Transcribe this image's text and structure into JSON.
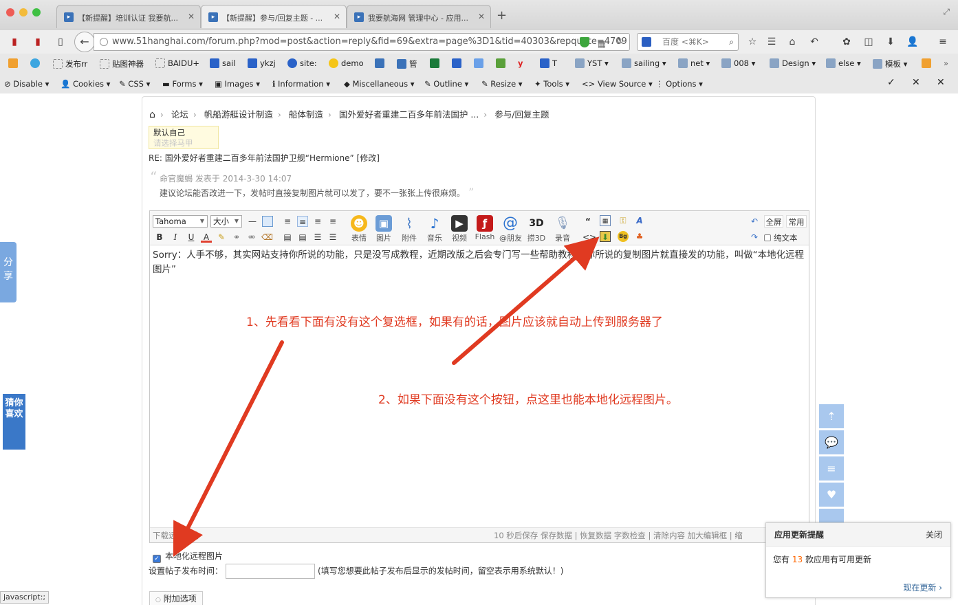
{
  "browser": {
    "tabs": [
      {
        "title": "【新提醒】培训认证 我要航..."
      },
      {
        "title": "【新提醒】参与/回复主题 - ..."
      },
      {
        "title": "我要航海网 管理中心 - 应用..."
      }
    ],
    "new_tab": "+",
    "url": "www.51hanghai.com/forum.php?mod=post&action=reply&fid=69&extra=page%3D1&tid=40303&repquote=4709",
    "search_placeholder": "百度 <⌘K>",
    "bookmarks": [
      "发布rr",
      "贴图神器",
      "BAIDU+",
      "sail",
      "ykzj",
      "site:",
      "demo",
      "管",
      "T"
    ],
    "bookmark_folders": [
      "YST",
      "sailing",
      "net",
      "008",
      "Design",
      "else",
      "模板"
    ],
    "devbar": [
      "Disable",
      "Cookies",
      "CSS",
      "Forms",
      "Images",
      "Information",
      "Miscellaneous",
      "Outline",
      "Resize",
      "Tools",
      "View Source",
      "Options"
    ],
    "status_url": "javascript:;"
  },
  "breadcrumb": [
    "论坛",
    "帆船游艇设计制造",
    "船体制造",
    "国外爱好者重建二百多年前法国护 ...",
    "参与/回复主题"
  ],
  "majia": {
    "label": "默认自己",
    "placeholder": "请选择马甲"
  },
  "reply_title": "RE: 国外爱好者重建二百多年前法国护卫舰“Hermione” [修改]",
  "quote": {
    "author_line": "命官魔蝎 发表于 2014-3-30 14:07",
    "text": "建议论坛能否改进一下，发帖时直接复制图片就可以发了，要不一张张上传很麻烦。"
  },
  "editor": {
    "font": "Tahoma",
    "size": "大小",
    "tools": [
      "表情",
      "图片",
      "附件",
      "音乐",
      "视频",
      "Flash",
      "@朋友",
      "捞3D",
      "录音"
    ],
    "fullscreen": "全屏",
    "common": "常用",
    "plaintext": "纯文本",
    "content": "Sorry：人手不够，其实网站支持你所说的功能，只是没写成教程，近期改版之后会专门写一些帮助教程。你所说的复制图片就直接发的功能，叫做“本地化远程图片”",
    "status_left": "下载远程图片",
    "status_right": "10 秒后保存 保存数据 | 恢复数据    字数检查 | 清除内容    加大编辑框 | 缩"
  },
  "options": {
    "localize_label": "本地化远程图片",
    "post_time_label": "设置帖子发布时间：",
    "post_time_hint": "(填写您想要此帖子发布后显示的发帖时间，留空表示用系统默认！)",
    "extra_tab": "附加选项"
  },
  "annotations": {
    "one": "1、先看看下面有没有这个复选框，如果有的话，图片应该就自动上传到服务器了",
    "two": "2、如果下面没有这个按钮，点这里也能本地化远程图片。"
  },
  "side": {
    "share": "分享",
    "guess": "猜你喜欢"
  },
  "notify": {
    "title": "应用更新提醒",
    "close": "关闭",
    "text_pre": "您有",
    "count": "13",
    "text_post": "款应用有可用更新",
    "now": "现在更新 ›"
  }
}
